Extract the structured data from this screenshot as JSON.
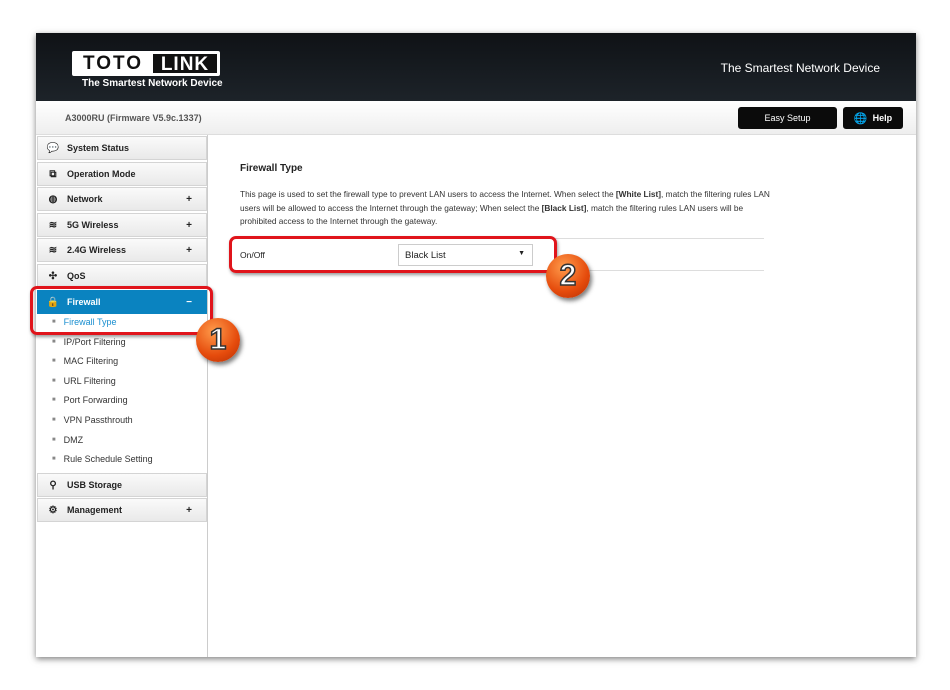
{
  "header": {
    "logo_left": "TOTO",
    "logo_right": "LINK",
    "logo_tagline": "The Smartest Network Device",
    "tagline": "The Smartest Network Device"
  },
  "subbar": {
    "model": "A3000RU (Firmware V5.9c.1337)",
    "easy_setup": "Easy Setup",
    "help": "Help"
  },
  "sidebar": {
    "items": [
      {
        "label": "System Status",
        "icon": "chat-icon",
        "expand": ""
      },
      {
        "label": "Operation Mode",
        "icon": "windows-icon",
        "expand": ""
      },
      {
        "label": "Network",
        "icon": "globe-icon",
        "expand": "+"
      },
      {
        "label": "5G Wireless",
        "icon": "wifi-icon",
        "expand": "+"
      },
      {
        "label": "2.4G Wireless",
        "icon": "wifi-icon",
        "expand": "+"
      },
      {
        "label": "QoS",
        "icon": "qos-icon",
        "expand": ""
      },
      {
        "label": "Firewall",
        "icon": "lock-icon",
        "expand": "−",
        "active": true
      },
      {
        "label": "USB Storage",
        "icon": "usb-icon",
        "expand": ""
      },
      {
        "label": "Management",
        "icon": "gear-icon",
        "expand": "+"
      }
    ],
    "firewall_sub": [
      "Firewall Type",
      "IP/Port Filtering",
      "MAC Filtering",
      "URL Filtering",
      "Port Forwarding",
      "VPN Passthrouth",
      "DMZ",
      "Rule Schedule Setting"
    ]
  },
  "main": {
    "title": "Firewall Type",
    "desc_1": "This page is used to set the firewall type to prevent LAN users to access the Internet. When select the ",
    "desc_b1": "[White List]",
    "desc_2": ", match the filtering rules LAN users will be allowed to access the Internet through the gateway; When select the ",
    "desc_b2": "[Black List]",
    "desc_3": ", match the filtering rules LAN users will be prohibited access to the Internet through the gateway.",
    "row_label": "On/Off",
    "select_value": "Black List"
  },
  "annotations": {
    "step1": "1",
    "step2": "2",
    "color": "#e0141b"
  },
  "colors": {
    "accent": "#0a83c0",
    "header": "#14181d"
  }
}
